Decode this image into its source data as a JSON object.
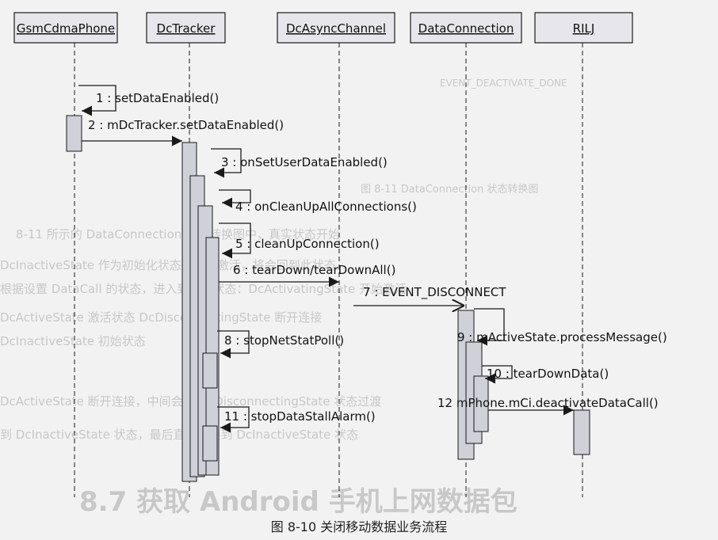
{
  "lifelines": [
    {
      "id": "GsmCdmaPhone",
      "label": "GsmCdmaPhone"
    },
    {
      "id": "DcTracker",
      "label": "DcTracker"
    },
    {
      "id": "DcAsyncChannel",
      "label": "DcAsyncChannel"
    },
    {
      "id": "DataConnection",
      "label": "DataConnection"
    },
    {
      "id": "RILJ",
      "label": "RILJ"
    }
  ],
  "messages": [
    {
      "num": "1",
      "text": "setDataEnabled()",
      "from": "GsmCdmaPhone",
      "to": "GsmCdmaPhone",
      "self": true
    },
    {
      "num": "2",
      "text": "mDcTracker.setDataEnabled()",
      "from": "GsmCdmaPhone",
      "to": "DcTracker",
      "self": false
    },
    {
      "num": "3",
      "text": "onSetUserDataEnabled()",
      "from": "DcTracker",
      "to": "DcTracker",
      "self": true
    },
    {
      "num": "4",
      "text": "onCleanUpAllConnections()",
      "from": "DcTracker",
      "to": "DcTracker",
      "self": true
    },
    {
      "num": "5",
      "text": "cleanUpConnection()",
      "from": "DcTracker",
      "to": "DcTracker",
      "self": true
    },
    {
      "num": "6",
      "text": "tearDown/tearDownAll()",
      "from": "DcTracker",
      "to": "DcAsyncChannel",
      "self": false
    },
    {
      "num": "7",
      "text": "EVENT_DISCONNECT",
      "from": "DcAsyncChannel",
      "to": "DataConnection",
      "self": false
    },
    {
      "num": "8",
      "text": "stopNetStatPoll()",
      "from": "DcTracker",
      "to": "DcTracker",
      "self": true
    },
    {
      "num": "9",
      "text": "mActiveState.processMessage()",
      "from": "DataConnection",
      "to": "DataConnection",
      "self": true
    },
    {
      "num": "10",
      "text": "tearDownData()",
      "from": "DataConnection",
      "to": "DataConnection",
      "self": true
    },
    {
      "num": "11",
      "text": "stopDataStallAlarm()",
      "from": "DcTracker",
      "to": "DcTracker",
      "self": true
    },
    {
      "num": "12",
      "text": "mPhone.mCi.deactivateDataCall()",
      "from": "DataConnection",
      "to": "RILJ",
      "self": false
    }
  ],
  "caption": "图 8-10  关闭移动数据业务流程",
  "background_text": {
    "t1": "EVENT_DEACTIVATE_DONE",
    "t2": "图 8-11  DataConnection 状态转换图",
    "t3": "8-11 所示的 DataConnection 状态转换图中，真实状态开始",
    "t4": "DcInactiveState 作为初始化状态，预先激活，将会回到此状态。",
    "t5": "根据设置 DataCall 的状态，进入到相应状态：DcActivatingState 开始激活",
    "t6": "DcActiveState 激活状态 DcDisconnectingState 断开连接",
    "t7": "DcInactiveState 初始状态",
    "t8": "DcActiveState 断开连接，中间会由 DcDisconnectingState 状态过渡",
    "t9": "到 DcInactiveState 状态，最后直接转换到 DcInactiveState 状态",
    "t10": "8.7  获取 Android 手机上网数据包"
  },
  "colors": {
    "lifeline_fill": "#e6e6ec",
    "activation_fill": "#cfd0d8",
    "line": "#1a1a1a",
    "ghost": "#c8c8c8"
  }
}
